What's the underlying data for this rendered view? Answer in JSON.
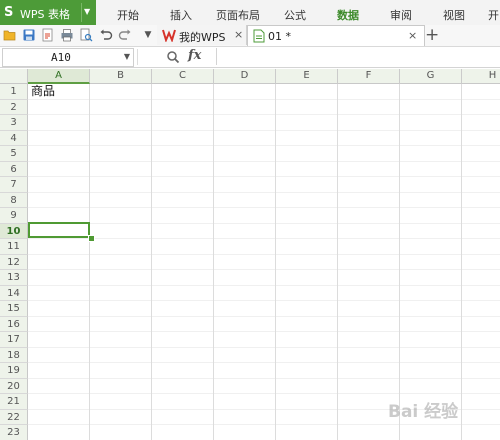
{
  "app": {
    "logo": "S",
    "title": "WPS 表格"
  },
  "menu": [
    "开始",
    "插入",
    "页面布局",
    "公式",
    "数据",
    "审阅",
    "视图",
    "开"
  ],
  "active_menu_index": 4,
  "tabs": [
    {
      "label": "我的WPS",
      "close": "×"
    },
    {
      "label": "01 *",
      "close": "×"
    }
  ],
  "new_tab": "+",
  "formula_bar": {
    "name_box": "A10",
    "fx": "fx",
    "formula": ""
  },
  "columns": [
    "A",
    "B",
    "C",
    "D",
    "E",
    "F",
    "G",
    "H"
  ],
  "rows": [
    "1",
    "2",
    "3",
    "4",
    "5",
    "6",
    "7",
    "8",
    "9",
    "10",
    "11",
    "12",
    "13",
    "14",
    "15",
    "16",
    "17",
    "18",
    "19",
    "20",
    "21",
    "22",
    "23"
  ],
  "active_row": "10",
  "active_column": "A",
  "cells": {
    "A1": "商品"
  },
  "watermark": "Bai 经验",
  "colors": {
    "accent": "#4d9b38",
    "selection": "#4f9a33",
    "header_bg": "#eef3ea"
  }
}
